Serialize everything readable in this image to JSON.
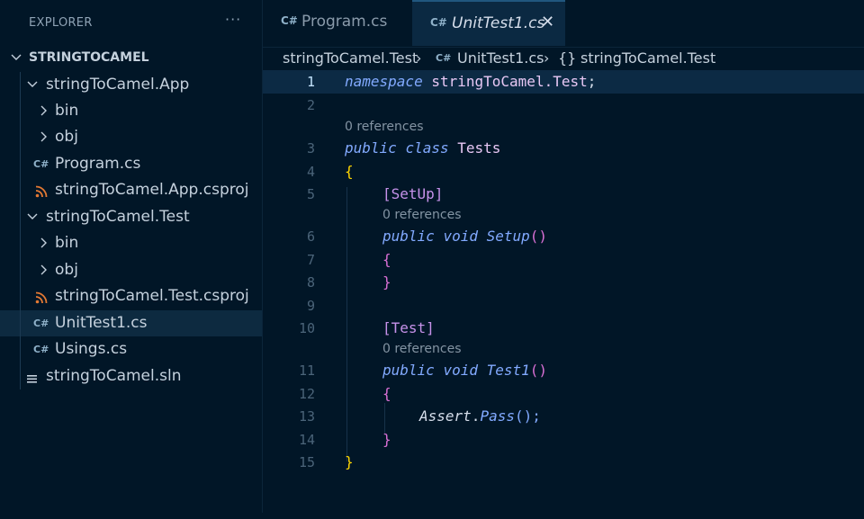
{
  "explorer": {
    "title": "EXPLORER",
    "more": "···",
    "root": "STRINGTOCAMEL",
    "items": [
      {
        "label": "stringToCamel.App"
      },
      {
        "label": "bin"
      },
      {
        "label": "obj"
      },
      {
        "label": "Program.cs"
      },
      {
        "label": "stringToCamel.App.csproj"
      },
      {
        "label": "stringToCamel.Test"
      },
      {
        "label": "bin"
      },
      {
        "label": "obj"
      },
      {
        "label": "stringToCamel.Test.csproj"
      },
      {
        "label": "UnitTest1.cs"
      },
      {
        "label": "Usings.cs"
      },
      {
        "label": "stringToCamel.sln"
      }
    ]
  },
  "tabs": [
    {
      "label": "Program.cs"
    },
    {
      "label": "UnitTest1.cs",
      "close": "✕"
    }
  ],
  "breadcrumb": {
    "part1": "stringToCamel.Test",
    "sep": "›",
    "part2": "UnitTest1.cs",
    "part3_icon": "{}",
    "part3": "stringToCamel.Test"
  },
  "editor": {
    "line_numbers": [
      "1",
      "2",
      "3",
      "4",
      "5",
      "6",
      "7",
      "8",
      "9",
      "10",
      "11",
      "12",
      "13",
      "14",
      "15"
    ],
    "codelens": "0 references",
    "tokens": {
      "namespace": "namespace",
      "ns_name": "stringToCamel.Test",
      "semicolon": ";",
      "public": "public",
      "class": "class",
      "class_name": "Tests",
      "open_brace": "{",
      "close_brace": "}",
      "setup_attr": "[SetUp]",
      "void": "void",
      "setup_name": "Setup",
      "parens": "()",
      "test_attr": "[Test]",
      "test_name": "Test1",
      "assert": "Assert",
      "dot": ".",
      "pass": "Pass",
      "call_end": "();"
    }
  },
  "colors": {
    "background": "#011627",
    "keyword": "#82aaff",
    "attribute": "#c792ea",
    "brace_outer": "#ffd700",
    "brace_inner": "#da70d6"
  }
}
